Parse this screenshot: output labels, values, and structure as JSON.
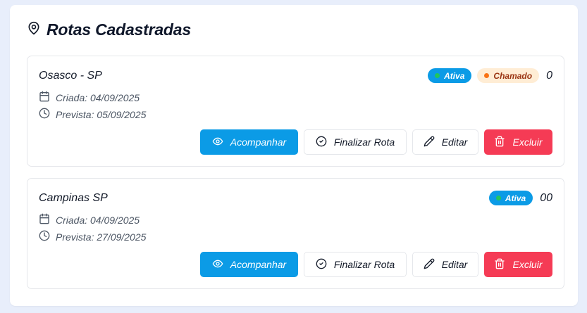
{
  "header": {
    "title": "Rotas Cadastradas",
    "icon": "map-pin-icon"
  },
  "labels": {
    "created_prefix": "Criada:",
    "expected_prefix": "Prevista:",
    "view": "Acompanhar",
    "finish": "Finalizar Rota",
    "edit": "Editar",
    "delete": "Excluir"
  },
  "routes": [
    {
      "name": "Osasco - SP",
      "created": "Criada: 04/09/2025",
      "expected": "Prevista: 05/09/2025",
      "badges": [
        {
          "label": "Ativa",
          "kind": "active"
        },
        {
          "label": "Chamado",
          "kind": "called"
        }
      ],
      "count": "0"
    },
    {
      "name": "Campinas SP",
      "created": "Criada: 04/09/2025",
      "expected": "Prevista: 27/09/2025",
      "badges": [
        {
          "label": "Ativa",
          "kind": "active"
        }
      ],
      "count": "00"
    }
  ],
  "colors": {
    "primary": "#0b9be6",
    "danger": "#f53b55",
    "active_dot": "#22c55e",
    "called_dot": "#f97316",
    "called_bg": "#ffedd5",
    "called_text": "#9a3412"
  }
}
